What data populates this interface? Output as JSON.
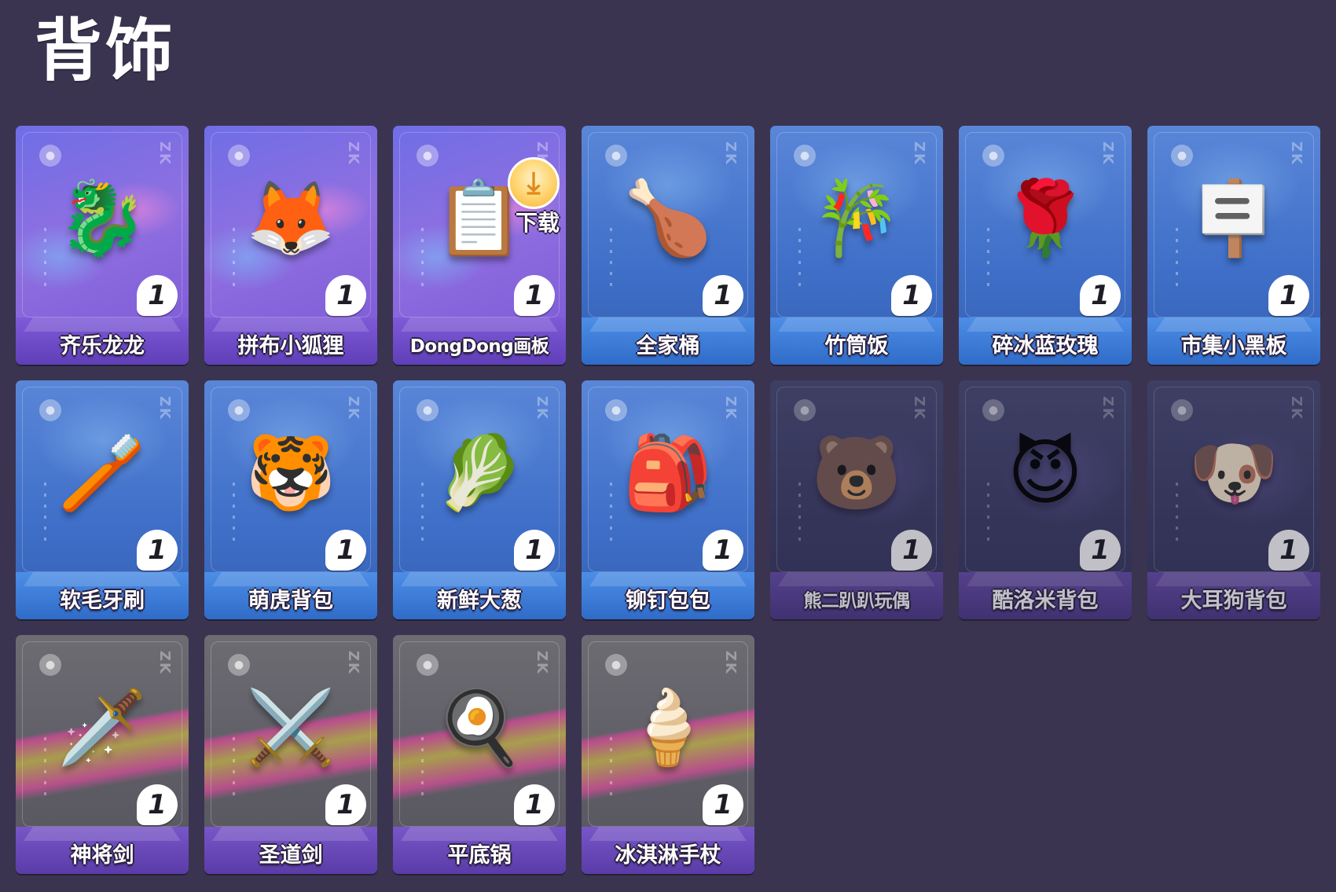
{
  "page": {
    "title": "背饰"
  },
  "items": [
    {
      "name": "齐乐龙龙",
      "qty": "1",
      "tier": "purple",
      "icon": "🐉",
      "icon_name": "dragon-doll-icon"
    },
    {
      "name": "拼布小狐狸",
      "qty": "1",
      "tier": "purple",
      "icon": "🦊",
      "icon_name": "fox-doll-icon"
    },
    {
      "name": "DongDong画板",
      "qty": "1",
      "tier": "purple",
      "icon": "📋",
      "icon_name": "drawing-board-icon"
    },
    {
      "name": "全家桶",
      "qty": "1",
      "tier": "blue",
      "icon": "🍗",
      "icon_name": "family-bucket-icon"
    },
    {
      "name": "竹筒饭",
      "qty": "1",
      "tier": "blue",
      "icon": "🎋",
      "icon_name": "bamboo-rice-icon"
    },
    {
      "name": "碎冰蓝玫瑰",
      "qty": "1",
      "tier": "blue",
      "icon": "🌹",
      "icon_name": "blue-rose-icon"
    },
    {
      "name": "市集小黑板",
      "qty": "1",
      "tier": "blue",
      "icon": "🪧",
      "icon_name": "chalkboard-icon"
    },
    {
      "name": "软毛牙刷",
      "qty": "1",
      "tier": "blue",
      "icon": "🪥",
      "icon_name": "toothbrush-icon"
    },
    {
      "name": "萌虎背包",
      "qty": "1",
      "tier": "blue",
      "icon": "🐯",
      "icon_name": "tiger-backpack-icon"
    },
    {
      "name": "新鲜大葱",
      "qty": "1",
      "tier": "blue",
      "icon": "🥬",
      "icon_name": "scallion-icon"
    },
    {
      "name": "铆钉包包",
      "qty": "1",
      "tier": "blue",
      "icon": "🎒",
      "icon_name": "studded-backpack-icon"
    },
    {
      "name": "熊二趴趴玩偶",
      "qty": "1",
      "tier": "dark",
      "icon": "🐻",
      "icon_name": "bear-doll-icon"
    },
    {
      "name": "酷洛米背包",
      "qty": "1",
      "tier": "dark",
      "icon": "😈",
      "icon_name": "kuromi-backpack-icon"
    },
    {
      "name": "大耳狗背包",
      "qty": "1",
      "tier": "dark",
      "icon": "🐶",
      "icon_name": "cinnamoroll-backpack-icon"
    },
    {
      "name": "神将剑",
      "qty": "1",
      "tier": "gray",
      "icon": "🗡️",
      "icon_name": "sword-icon"
    },
    {
      "name": "圣道剑",
      "qty": "1",
      "tier": "gray",
      "icon": "⚔️",
      "icon_name": "holy-sword-icon"
    },
    {
      "name": "平底锅",
      "qty": "1",
      "tier": "gray",
      "icon": "🍳",
      "icon_name": "frying-pan-icon"
    },
    {
      "name": "冰淇淋手杖",
      "qty": "1",
      "tier": "gray",
      "icon": "🍦",
      "icon_name": "ice-cream-cane-icon"
    }
  ],
  "download_badge": {
    "label": "下载",
    "icon": "⤓",
    "icon_name": "download-icon"
  },
  "brand_mark": "ZK",
  "bomb_glyph": "●",
  "colors": {
    "background": "#3a3450",
    "purple_tier": "#7f5ad8",
    "blue_tier": "#4d8ee6",
    "dark_tier": "#4e3a8a",
    "gray_tier": "#5e5d66"
  }
}
